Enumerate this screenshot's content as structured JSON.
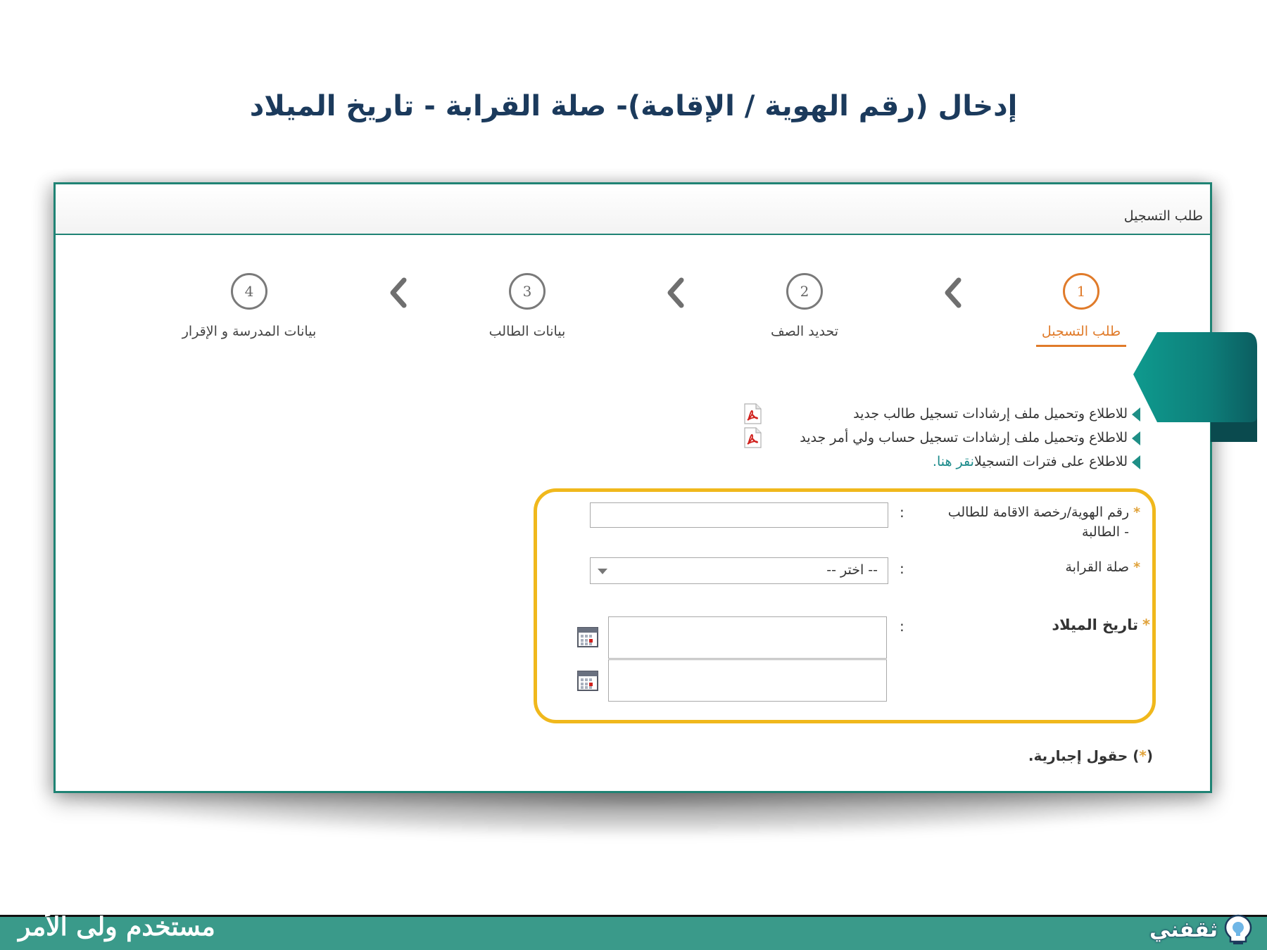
{
  "slide": {
    "title": "إدخال (رقم الهوية / الإقامة)- صلة القرابة - تاريخ الميلاد"
  },
  "panel": {
    "header_label": "طلب التسجيل"
  },
  "steps": [
    {
      "number": "1",
      "label": "طلب التسجبل",
      "active": true
    },
    {
      "number": "2",
      "label": "تحديد الصف",
      "active": false
    },
    {
      "number": "3",
      "label": "بيانات الطالب",
      "active": false
    },
    {
      "number": "4",
      "label": "بيانات المدرسة و الإقرار",
      "active": false
    }
  ],
  "info_links": [
    {
      "text": "للاطلاع وتحميل ملف إرشادات تسجيل طالب جديد",
      "icon": "pdf-icon"
    },
    {
      "text": "للاطلاع وتحميل ملف إرشادات تسجيل حساب ولي أمر جديد",
      "icon": "pdf-icon"
    },
    {
      "text": "للاطلاع على فترات التسجيل",
      "link_text": "انقر هنا."
    }
  ],
  "form": {
    "id_label_line1": "رقم الهوية/رخصة الاقامة للطالب",
    "id_label_line2": "- الطالبة",
    "id_value": "",
    "relation_label": "صلة القرابة",
    "relation_selected": "-- اختر --",
    "birthdate_label": "تاريخ الميلاد",
    "birthdate_hijri_value": "",
    "birthdate_gregorian_value": "",
    "required_mark": "*",
    "colon": ":"
  },
  "mandatory_note": {
    "prefix": "(",
    "mark": "*",
    "suffix": ") حقول إجبارية."
  },
  "footer": {
    "text": "مستخدم ولى الأمر",
    "brand": "ثقفني"
  },
  "colors": {
    "primary_teal": "#1f8374",
    "active_orange": "#e07b2a",
    "highlight_yellow": "#f0b81c",
    "title_navy": "#1b3a5c",
    "footer_teal": "#3a9a8a"
  }
}
